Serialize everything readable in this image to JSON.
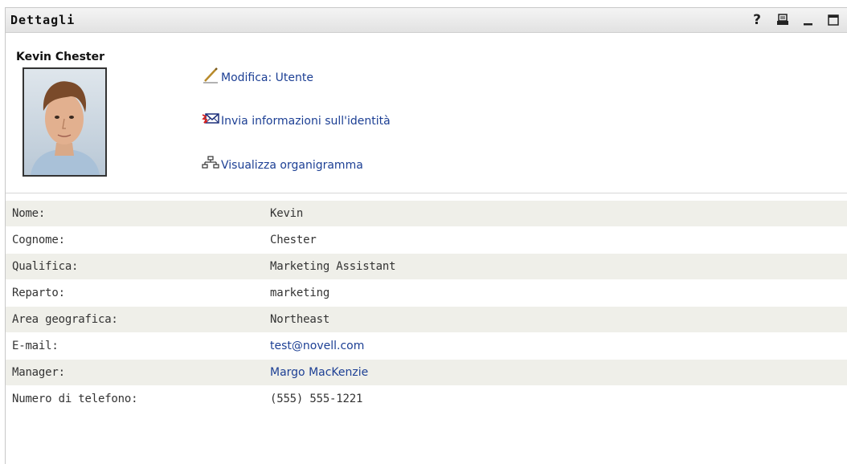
{
  "portlet": {
    "title": "Dettagli",
    "controls": {
      "help": "?",
      "print_icon": "print-icon",
      "minimize_icon": "minimize-icon",
      "maximize_icon": "maximize-icon"
    }
  },
  "user": {
    "full_name": "Kevin Chester",
    "photo": "user-photo"
  },
  "actions": [
    {
      "label": "Modifica: Utente",
      "icon": "pencil-icon"
    },
    {
      "label": "Invia informazioni sull'identità",
      "icon": "envelope-icon"
    },
    {
      "label": "Visualizza organigramma",
      "icon": "org-chart-icon"
    }
  ],
  "details": [
    {
      "label": "Nome:",
      "value": "Kevin"
    },
    {
      "label": "Cognome:",
      "value": "Chester"
    },
    {
      "label": "Qualifica:",
      "value": "Marketing Assistant"
    },
    {
      "label": "Reparto:",
      "value": "marketing"
    },
    {
      "label": "Area geografica:",
      "value": "Northeast"
    },
    {
      "label": "E-mail:",
      "value": "test@novell.com"
    },
    {
      "label": "Manager:",
      "value": "Margo MacKenzie"
    },
    {
      "label": "Numero di telefono:",
      "value": "(555) 555-1221"
    }
  ],
  "colors": {
    "link": "#1c3f94",
    "row_alt": "#efefe9",
    "titlebar": "#e8e8e8"
  }
}
